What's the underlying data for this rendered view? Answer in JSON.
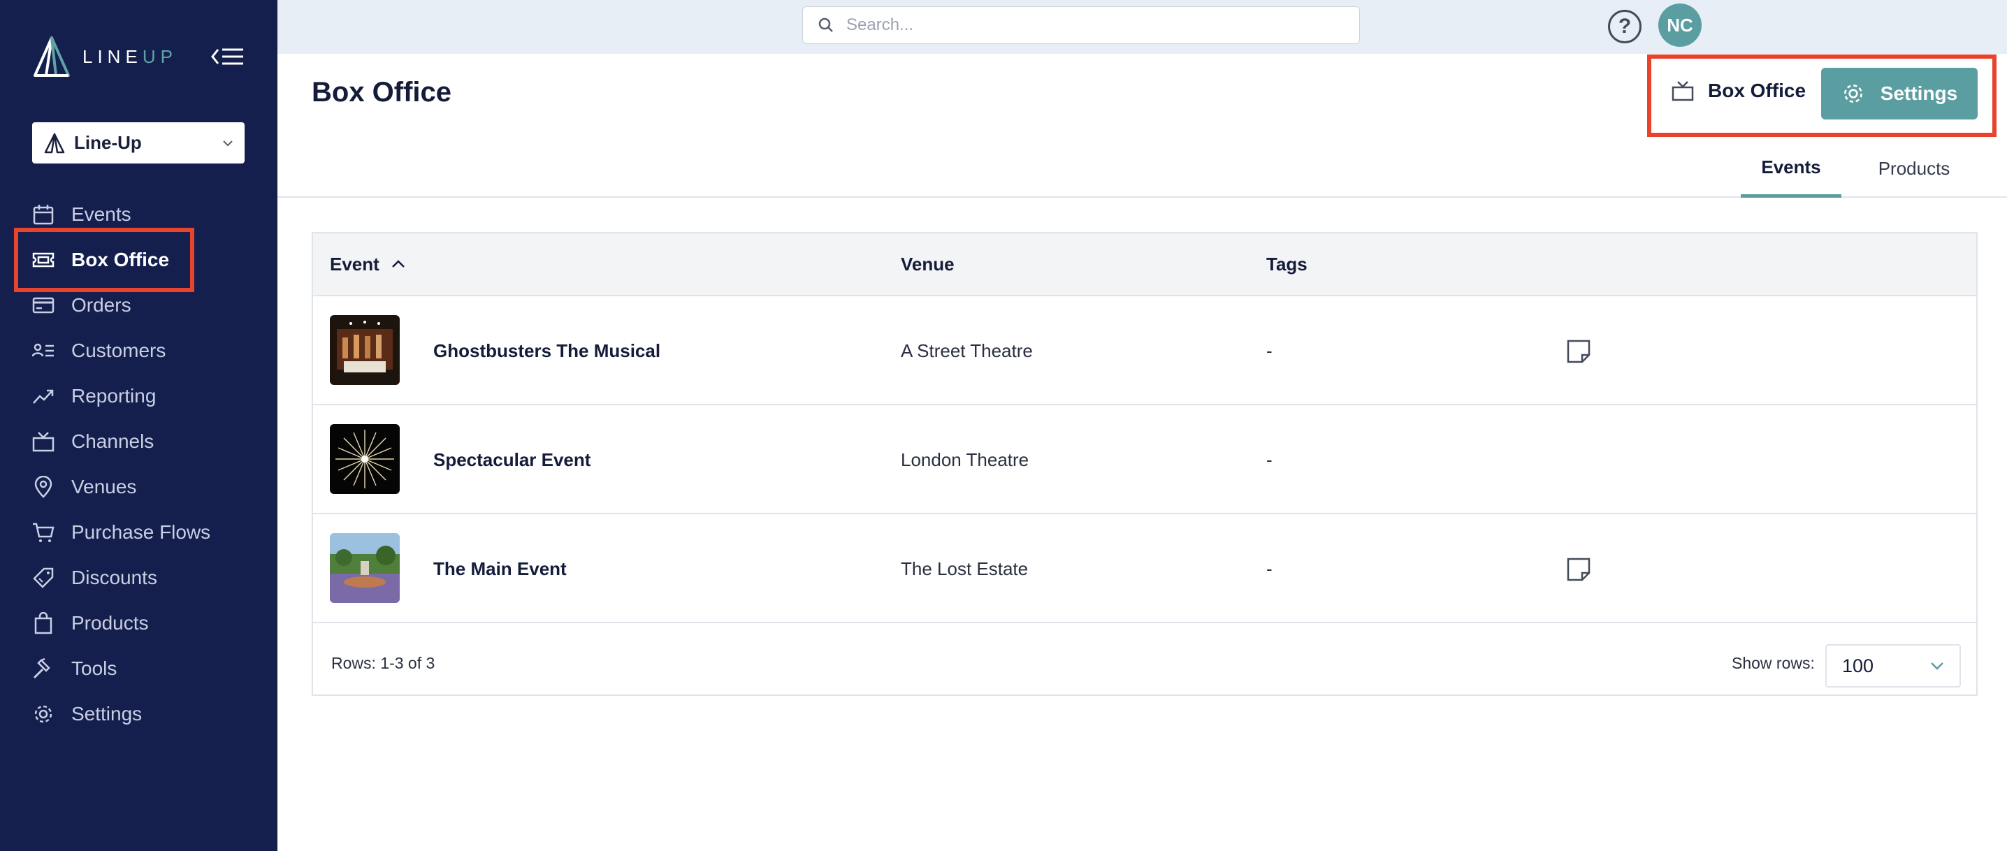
{
  "brand": {
    "logo_text_line": "LINE",
    "logo_text_up": "UP"
  },
  "org_selector": {
    "name": "Line-Up"
  },
  "nav": {
    "items": [
      {
        "label": "Events",
        "icon": "calendar-icon"
      },
      {
        "label": "Box Office",
        "icon": "ticket-icon",
        "active": true
      },
      {
        "label": "Orders",
        "icon": "credit-card-icon"
      },
      {
        "label": "Customers",
        "icon": "customers-icon"
      },
      {
        "label": "Reporting",
        "icon": "trend-icon"
      },
      {
        "label": "Channels",
        "icon": "tv-icon"
      },
      {
        "label": "Venues",
        "icon": "location-pin-icon"
      },
      {
        "label": "Purchase Flows",
        "icon": "cart-icon"
      },
      {
        "label": "Discounts",
        "icon": "tag-icon"
      },
      {
        "label": "Products",
        "icon": "bag-icon"
      },
      {
        "label": "Tools",
        "icon": "hammer-icon"
      },
      {
        "label": "Settings",
        "icon": "gear-icon"
      }
    ]
  },
  "topbar": {
    "search_placeholder": "Search...",
    "help_label": "?",
    "avatar_initials": "NC"
  },
  "header": {
    "title": "Box Office",
    "channel_label": "Box Office",
    "settings_label": "Settings"
  },
  "tabs": [
    {
      "label": "Events",
      "active": true
    },
    {
      "label": "Products",
      "active": false
    }
  ],
  "table": {
    "columns": {
      "event": "Event",
      "venue": "Venue",
      "tags": "Tags"
    },
    "rows": [
      {
        "name": "Ghostbusters The Musical",
        "venue": "A Street Theatre",
        "tags": "-",
        "has_note": true
      },
      {
        "name": "Spectacular Event",
        "venue": "London Theatre",
        "tags": "-",
        "has_note": false
      },
      {
        "name": "The Main Event",
        "venue": "The Lost Estate",
        "tags": "-",
        "has_note": true
      }
    ],
    "footer": {
      "rows_count": "Rows: 1-3 of 3",
      "show_rows_label": "Show rows:",
      "show_rows_value": "100"
    }
  },
  "colors": {
    "sidebar": "#141f4e",
    "accent": "#5a9ea2",
    "highlight": "#e8432c"
  }
}
